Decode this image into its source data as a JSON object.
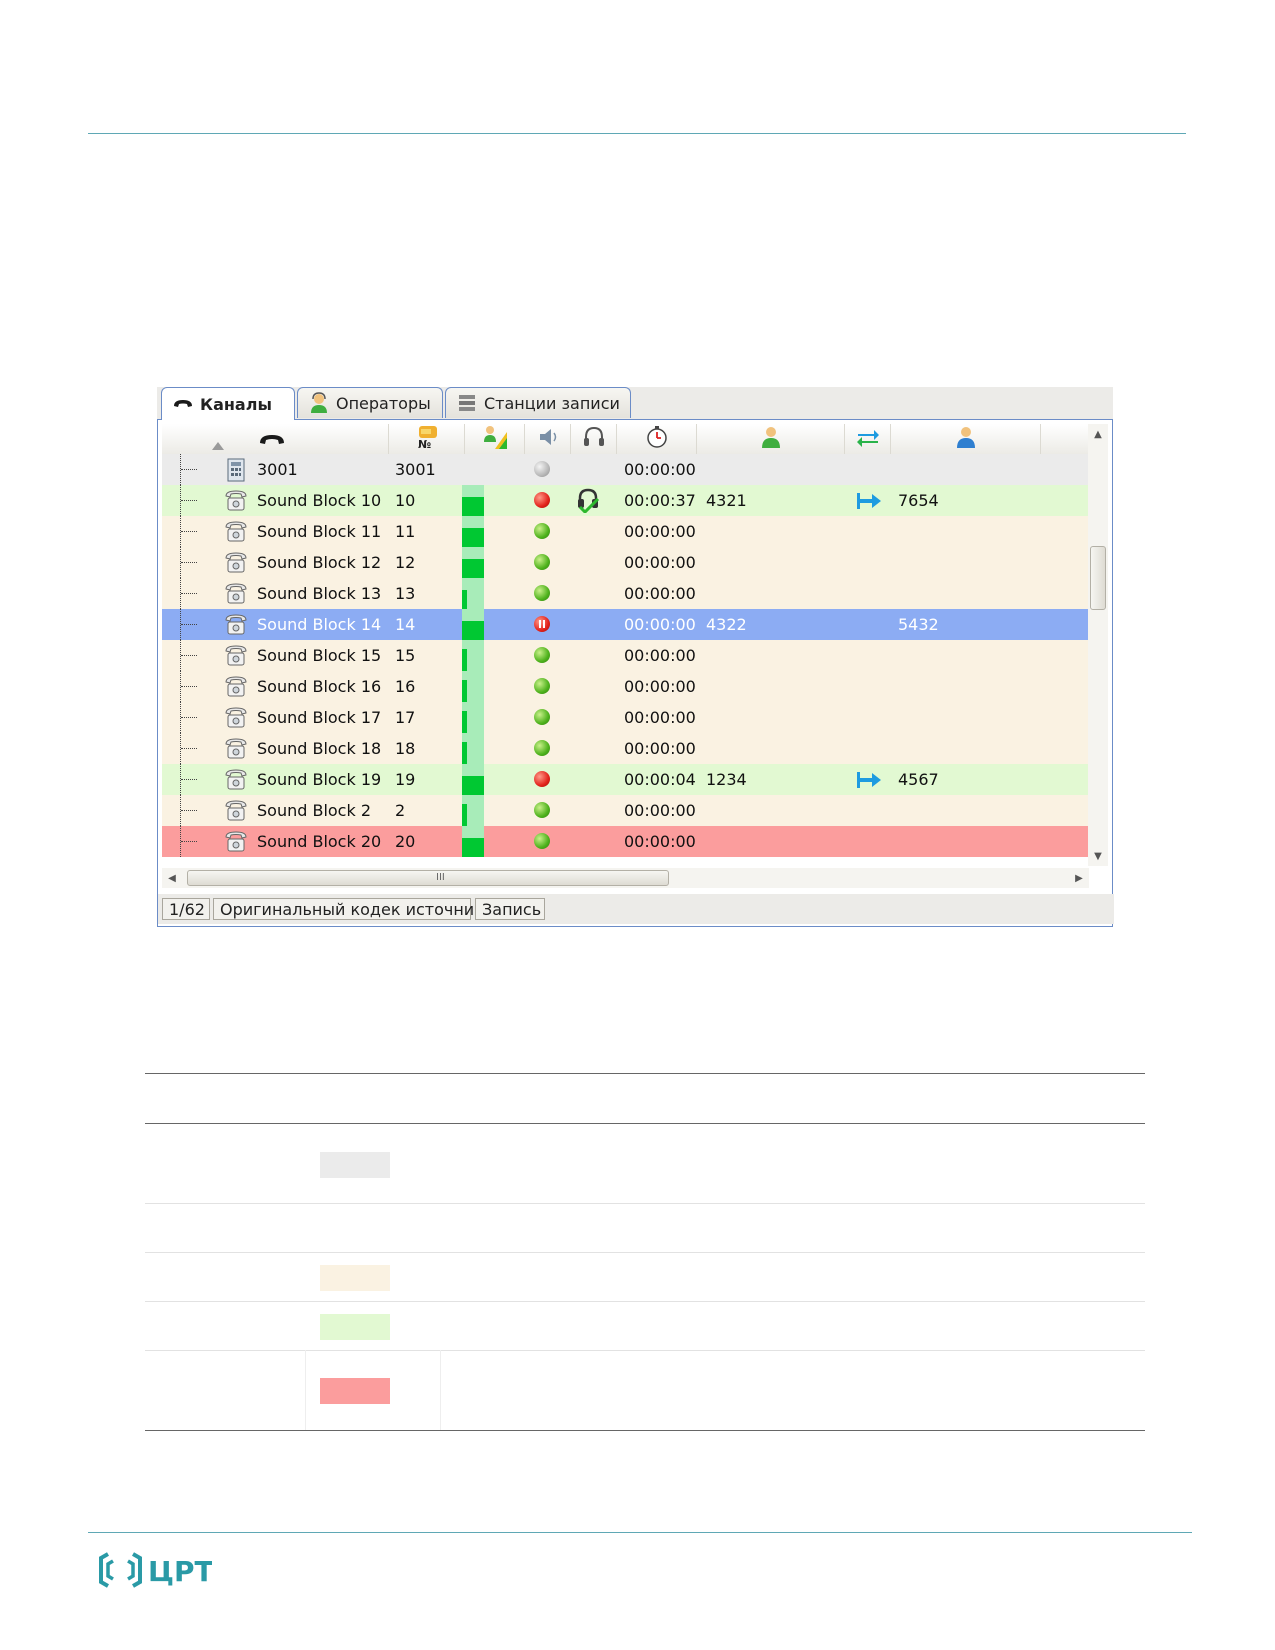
{
  "tabs": [
    {
      "label": "Каналы",
      "icon": "phone-handset-icon",
      "active": true
    },
    {
      "label": "Операторы",
      "icon": "operator-icon",
      "active": false
    },
    {
      "label": "Станции записи",
      "icon": "recording-station-icon",
      "active": false
    }
  ],
  "header_icons": [
    "sort-up-icon",
    "phone-handset-icon",
    "number-icon",
    "signal-level-icon",
    "speaker-icon",
    "headphones-icon",
    "timer-icon",
    "caller-icon",
    "transfer-icon",
    "callee-icon"
  ],
  "rows": [
    {
      "name": "3001",
      "num": "3001",
      "time": "00:00:00",
      "a": "",
      "b": "",
      "state": "idle",
      "indicator": "gray",
      "level": 0,
      "device": "phone-base-icon",
      "headset": false,
      "arrow": false
    },
    {
      "name": "Sound Block 10",
      "num": "10",
      "time": "00:00:37",
      "a": "4321",
      "b": "7654",
      "state": "busy",
      "indicator": "red",
      "level": 0.8,
      "device": "telephone-icon",
      "headset": true,
      "arrow": true
    },
    {
      "name": "Sound Block 11",
      "num": "11",
      "time": "00:00:00",
      "a": "",
      "b": "",
      "state": "free",
      "indicator": "green",
      "level": 0.8,
      "device": "telephone-icon",
      "headset": false,
      "arrow": false
    },
    {
      "name": "Sound Block 12",
      "num": "12",
      "time": "00:00:00",
      "a": "",
      "b": "",
      "state": "free",
      "indicator": "green",
      "level": 0.8,
      "device": "telephone-icon",
      "headset": false,
      "arrow": false
    },
    {
      "name": "Sound Block 13",
      "num": "13",
      "time": "00:00:00",
      "a": "",
      "b": "",
      "state": "free",
      "indicator": "green",
      "level": 0.6,
      "device": "telephone-icon",
      "headset": false,
      "arrow": false
    },
    {
      "name": "Sound Block 14",
      "num": "14",
      "time": "00:00:00",
      "a": "4322",
      "b": "5432",
      "state": "selected",
      "indicator": "pause",
      "level": 0.8,
      "device": "telephone-icon",
      "headset": false,
      "arrow": false
    },
    {
      "name": "Sound Block 15",
      "num": "15",
      "time": "00:00:00",
      "a": "",
      "b": "",
      "state": "free",
      "indicator": "green",
      "level": 0.7,
      "device": "telephone-icon",
      "headset": false,
      "arrow": false
    },
    {
      "name": "Sound Block 16",
      "num": "16",
      "time": "00:00:00",
      "a": "",
      "b": "",
      "state": "free",
      "indicator": "green",
      "level": 0.7,
      "device": "telephone-icon",
      "headset": false,
      "arrow": false
    },
    {
      "name": "Sound Block 17",
      "num": "17",
      "time": "00:00:00",
      "a": "",
      "b": "",
      "state": "free",
      "indicator": "green",
      "level": 0.7,
      "device": "telephone-icon",
      "headset": false,
      "arrow": false
    },
    {
      "name": "Sound Block 18",
      "num": "18",
      "time": "00:00:00",
      "a": "",
      "b": "",
      "state": "free",
      "indicator": "green",
      "level": 0.7,
      "device": "telephone-icon",
      "headset": false,
      "arrow": false
    },
    {
      "name": "Sound Block 19",
      "num": "19",
      "time": "00:00:04",
      "a": "1234",
      "b": "4567",
      "state": "busy",
      "indicator": "red",
      "level": 0.8,
      "device": "telephone-icon",
      "headset": false,
      "arrow": true
    },
    {
      "name": "Sound Block 2",
      "num": "2",
      "time": "00:00:00",
      "a": "",
      "b": "",
      "state": "free",
      "indicator": "green",
      "level": 0.7,
      "device": "telephone-icon",
      "headset": false,
      "arrow": false
    },
    {
      "name": "Sound Block 20",
      "num": "20",
      "time": "00:00:00",
      "a": "",
      "b": "",
      "state": "error",
      "indicator": "green",
      "level": 0.8,
      "device": "telephone-icon",
      "headset": false,
      "arrow": false
    }
  ],
  "scrollbar": {
    "grip": "III"
  },
  "status": {
    "page": "1/62",
    "codec": "Оригинальный кодек источника",
    "record": "Запись"
  },
  "legend_colors": [
    "#ebebeb",
    "#faf2e2",
    "#e2f9d2",
    "#fb9d9d"
  ],
  "row_colors": {
    "idle": "#ebebeb",
    "free": "#faf2e2",
    "busy": "#e2f9d2",
    "selected": "#8cacf3",
    "error": "#fb9d9d"
  },
  "accent_color": "#5fa8b5",
  "logo_text": "ЦРТ"
}
